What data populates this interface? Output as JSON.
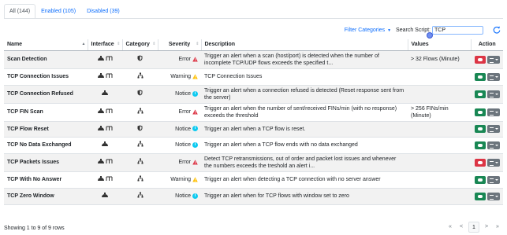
{
  "tabs": [
    {
      "label": "All (144)",
      "active": true
    },
    {
      "label": "Enabled (105)",
      "active": false
    },
    {
      "label": "Disabled (39)",
      "active": false
    }
  ],
  "toolbar": {
    "filter_label": "Filter Categories",
    "search_label": "Search Script:",
    "search_value": "TCP"
  },
  "columns": {
    "name": "Name",
    "interface": "Interface",
    "category": "Category",
    "severity": "Severity",
    "description": "Description",
    "values": "Values",
    "action": "Action"
  },
  "rows": [
    {
      "name": "Scan Detection",
      "iface": "host-flow",
      "category": "shield",
      "severity": "Error",
      "sev_type": "error",
      "description": "Trigger an alert when a scan (host/port) is detected when the number of incomplete TCP/UDP flows exceeds the specified t...",
      "values": "> 32 Flows (Minute)",
      "enabled": false
    },
    {
      "name": "TCP Connection Issues",
      "iface": "host-flow",
      "category": "network",
      "severity": "Warning",
      "sev_type": "warning",
      "description": "TCP Connection Issues",
      "values": "",
      "enabled": true
    },
    {
      "name": "TCP Connection Refused",
      "iface": "host",
      "category": "shield",
      "severity": "Notice",
      "sev_type": "notice",
      "description": "Trigger an alert when a connection refused is detected (Reset response sent from the server)",
      "values": "",
      "enabled": true
    },
    {
      "name": "TCP FIN Scan",
      "iface": "host-flow",
      "category": "network",
      "severity": "Error",
      "sev_type": "error",
      "description": "Trigger an alert when the number of sent/received FINs/min (with no response) exceeds the threshold",
      "values": "> 256 FINs/min (Minute)",
      "enabled": true
    },
    {
      "name": "TCP Flow Reset",
      "iface": "host-flow",
      "category": "shield",
      "severity": "Notice",
      "sev_type": "notice",
      "description": "Trigger an alert when a TCP flow is reset.",
      "values": "",
      "enabled": true
    },
    {
      "name": "TCP No Data Exchanged",
      "iface": "host",
      "category": "network",
      "severity": "Notice",
      "sev_type": "notice",
      "description": "Trigger an alert when a TCP flow ends with no data exchanged",
      "values": "",
      "enabled": true
    },
    {
      "name": "TCP Packets Issues",
      "iface": "host-flow",
      "category": "network",
      "severity": "Error",
      "sev_type": "error",
      "description": "Detect TCP retransmissions, out of order and packet lost issues and whenever the numbers exceeds the treshold an alert i...",
      "values": "",
      "enabled": false
    },
    {
      "name": "TCP With No Answer",
      "iface": "host-flow",
      "category": "network",
      "severity": "Warning",
      "sev_type": "warning",
      "description": "Trigger an alert when detecting a TCP connection with no server answer",
      "values": "",
      "enabled": true
    },
    {
      "name": "TCP Zero Window",
      "iface": "host",
      "category": "network",
      "severity": "Notice",
      "sev_type": "notice",
      "description": "Trigger an alert when for TCP flows with window set to zero",
      "values": "",
      "enabled": true
    }
  ],
  "footer": {
    "showing": "Showing 1 to 9 of 9 rows",
    "first": "«",
    "prev": "<",
    "page": "1",
    "next": ">",
    "last": "»"
  },
  "colors": {
    "link": "#0d6efd",
    "error": "#dc3545",
    "warning": "#ffc107",
    "notice": "#0dcaf0",
    "enabled_btn": "#198754",
    "disabled_btn": "#dc3545"
  }
}
